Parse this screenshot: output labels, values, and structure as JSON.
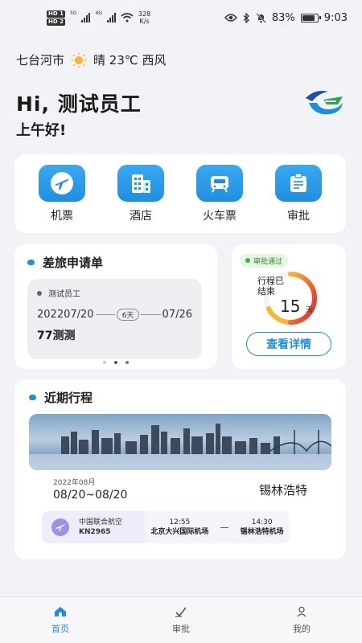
{
  "status_bar": {
    "net_labels": [
      "5G",
      "4G"
    ],
    "speed_value": "328",
    "speed_unit": "K/s",
    "battery": "83%",
    "time": "9:03"
  },
  "location": {
    "city": "七台河市",
    "weather": "晴 23℃ 西风"
  },
  "greeting": {
    "hello": "Hi, 测试员工",
    "sub": "上午好!"
  },
  "quick_actions": [
    {
      "label": "机票",
      "icon": "flight-ticket-icon"
    },
    {
      "label": "酒店",
      "icon": "hotel-icon"
    },
    {
      "label": "火车票",
      "icon": "train-icon"
    },
    {
      "label": "审批",
      "icon": "approval-icon"
    }
  ],
  "application": {
    "title": "差旅申请单",
    "applicant": "测试员工",
    "start_date": "202207/20",
    "days": "6天",
    "end_date": "07/26",
    "trip_name": "77测测",
    "page_count": 3,
    "active_page": 1
  },
  "approval": {
    "badge": "审批通过",
    "label_line1": "行程已",
    "label_line2": "结束",
    "days_value": "15",
    "days_unit": "天",
    "button": "查看详情"
  },
  "recent": {
    "title": "近期行程",
    "month": "2022年08月",
    "dates": "08/20~08/20",
    "destination": "锡林浩特",
    "airline": "中国联合航空",
    "flight_no": "KN2965",
    "dep_time": "12:55",
    "dep_airport": "北京大兴国际机场",
    "arr_time": "14:30",
    "arr_airport": "锡林浩特机场"
  },
  "nav": [
    {
      "label": "首页",
      "icon": "home-icon",
      "active": true
    },
    {
      "label": "审批",
      "icon": "check-icon",
      "active": false
    },
    {
      "label": "我的",
      "icon": "user-icon",
      "active": false
    }
  ],
  "colors": {
    "accent": "#1e8fe0",
    "success": "#3cb043",
    "gauge_start": "#f7b731",
    "gauge_end": "#e6202a"
  }
}
